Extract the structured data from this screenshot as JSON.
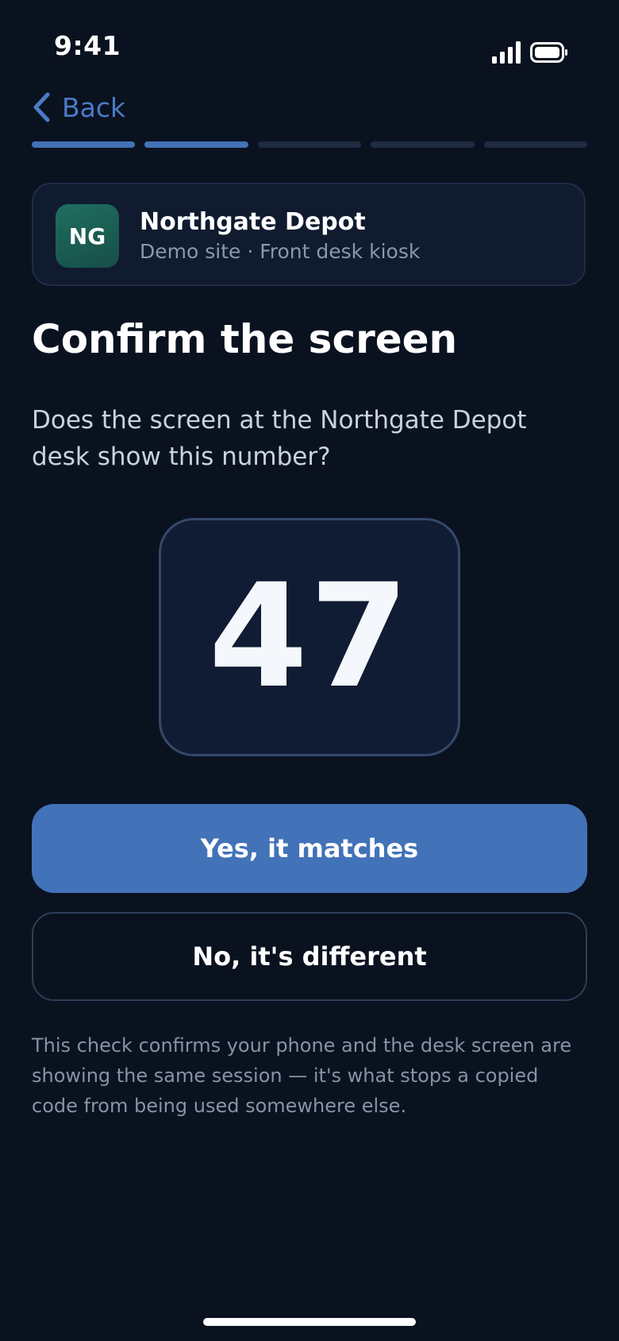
{
  "status_bar": {
    "time": "9:41",
    "signal_icon": "cellular-signal-icon",
    "battery_icon": "battery-icon"
  },
  "nav": {
    "back_label": "Back",
    "back_icon": "chevron-left-icon"
  },
  "progress": {
    "total_steps": 5,
    "completed_steps": 2
  },
  "site": {
    "initials": "NG",
    "name": "Northgate Depot",
    "subtitle": "Demo site · Front desk kiosk"
  },
  "main": {
    "title": "Confirm the screen",
    "description": "Does the screen at the Northgate Depot desk show this number?",
    "number": "47"
  },
  "actions": {
    "confirm_label": "Yes, it matches",
    "reject_label": "No, it's different"
  },
  "footnote": "This check confirms your phone and the desk screen are showing the same session — it's what stops a copied code from being used somewhere else.",
  "colors": {
    "background": "#0a1220",
    "accent": "#4272b8",
    "avatar": "#1f6e5f",
    "card": "#101b2f"
  }
}
